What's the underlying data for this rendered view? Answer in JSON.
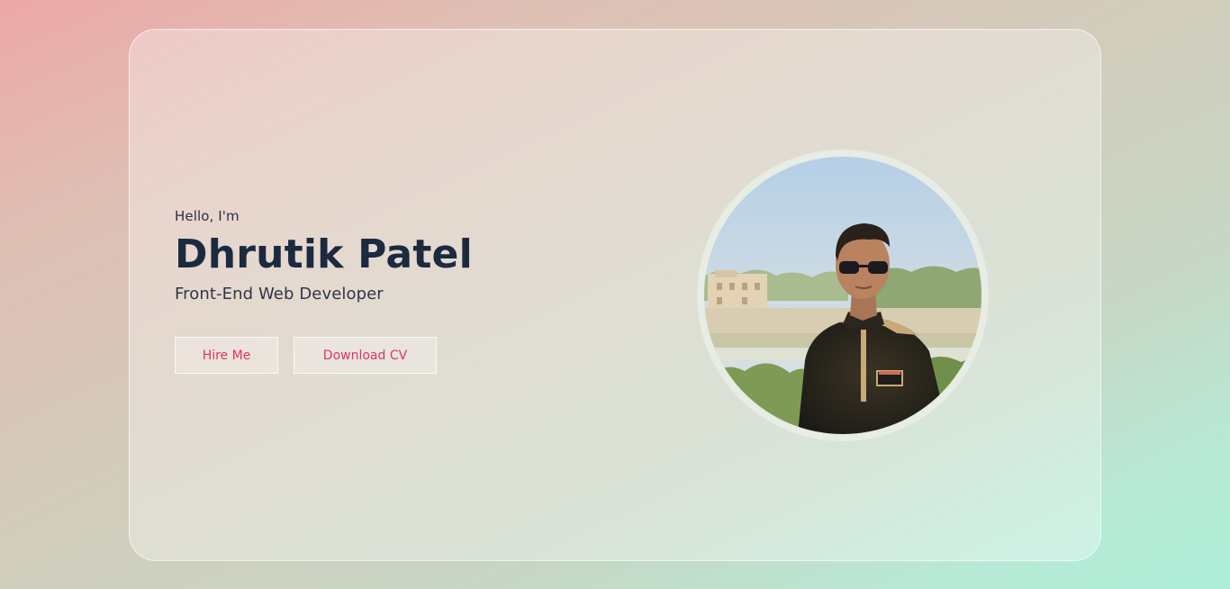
{
  "hero": {
    "greeting": "Hello, I'm",
    "name": "Dhrutik Patel",
    "role": "Front-End Web Developer"
  },
  "buttons": {
    "hire_label": "Hire Me",
    "cv_label": "Download CV"
  },
  "colors": {
    "accent": "#e0355f",
    "name_text": "#1c2a3f"
  }
}
